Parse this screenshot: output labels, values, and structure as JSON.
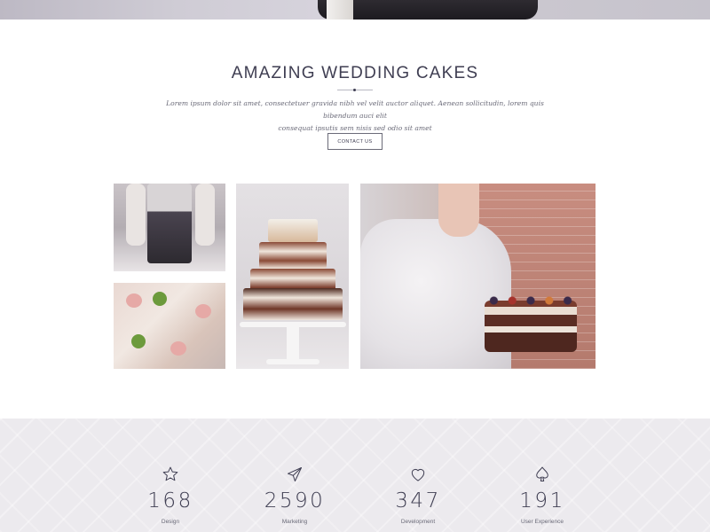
{
  "section": {
    "title": "AMAZING WEDDING CAKES",
    "intro_line1": "Lorem ipsum dolor sit amet, consectetuer gravida nibh vel velit auctor aliquet. Aenean sollicitudin, lorem quis bibendum auci elit",
    "intro_line2": "consequat ipsutis sem nisis sed odio sit amet",
    "contact_label": "CONTACT US"
  },
  "gallery": [
    {
      "name": "cake-held-photo"
    },
    {
      "name": "floral-cake-detail-photo"
    },
    {
      "name": "naked-cake-stand-photo"
    },
    {
      "name": "bride-with-cake-photo"
    }
  ],
  "stats": [
    {
      "icon": "star-icon",
      "value": "168",
      "label": "Design"
    },
    {
      "icon": "paper-plane-icon",
      "value": "2590",
      "label": "Marketing"
    },
    {
      "icon": "heart-icon",
      "value": "347",
      "label": "Development"
    },
    {
      "icon": "spade-icon",
      "value": "191",
      "label": "User Experience"
    }
  ],
  "colors": {
    "heading": "#3f3e52",
    "body_text": "#6a6a78",
    "stats_background": "#eceaee"
  }
}
